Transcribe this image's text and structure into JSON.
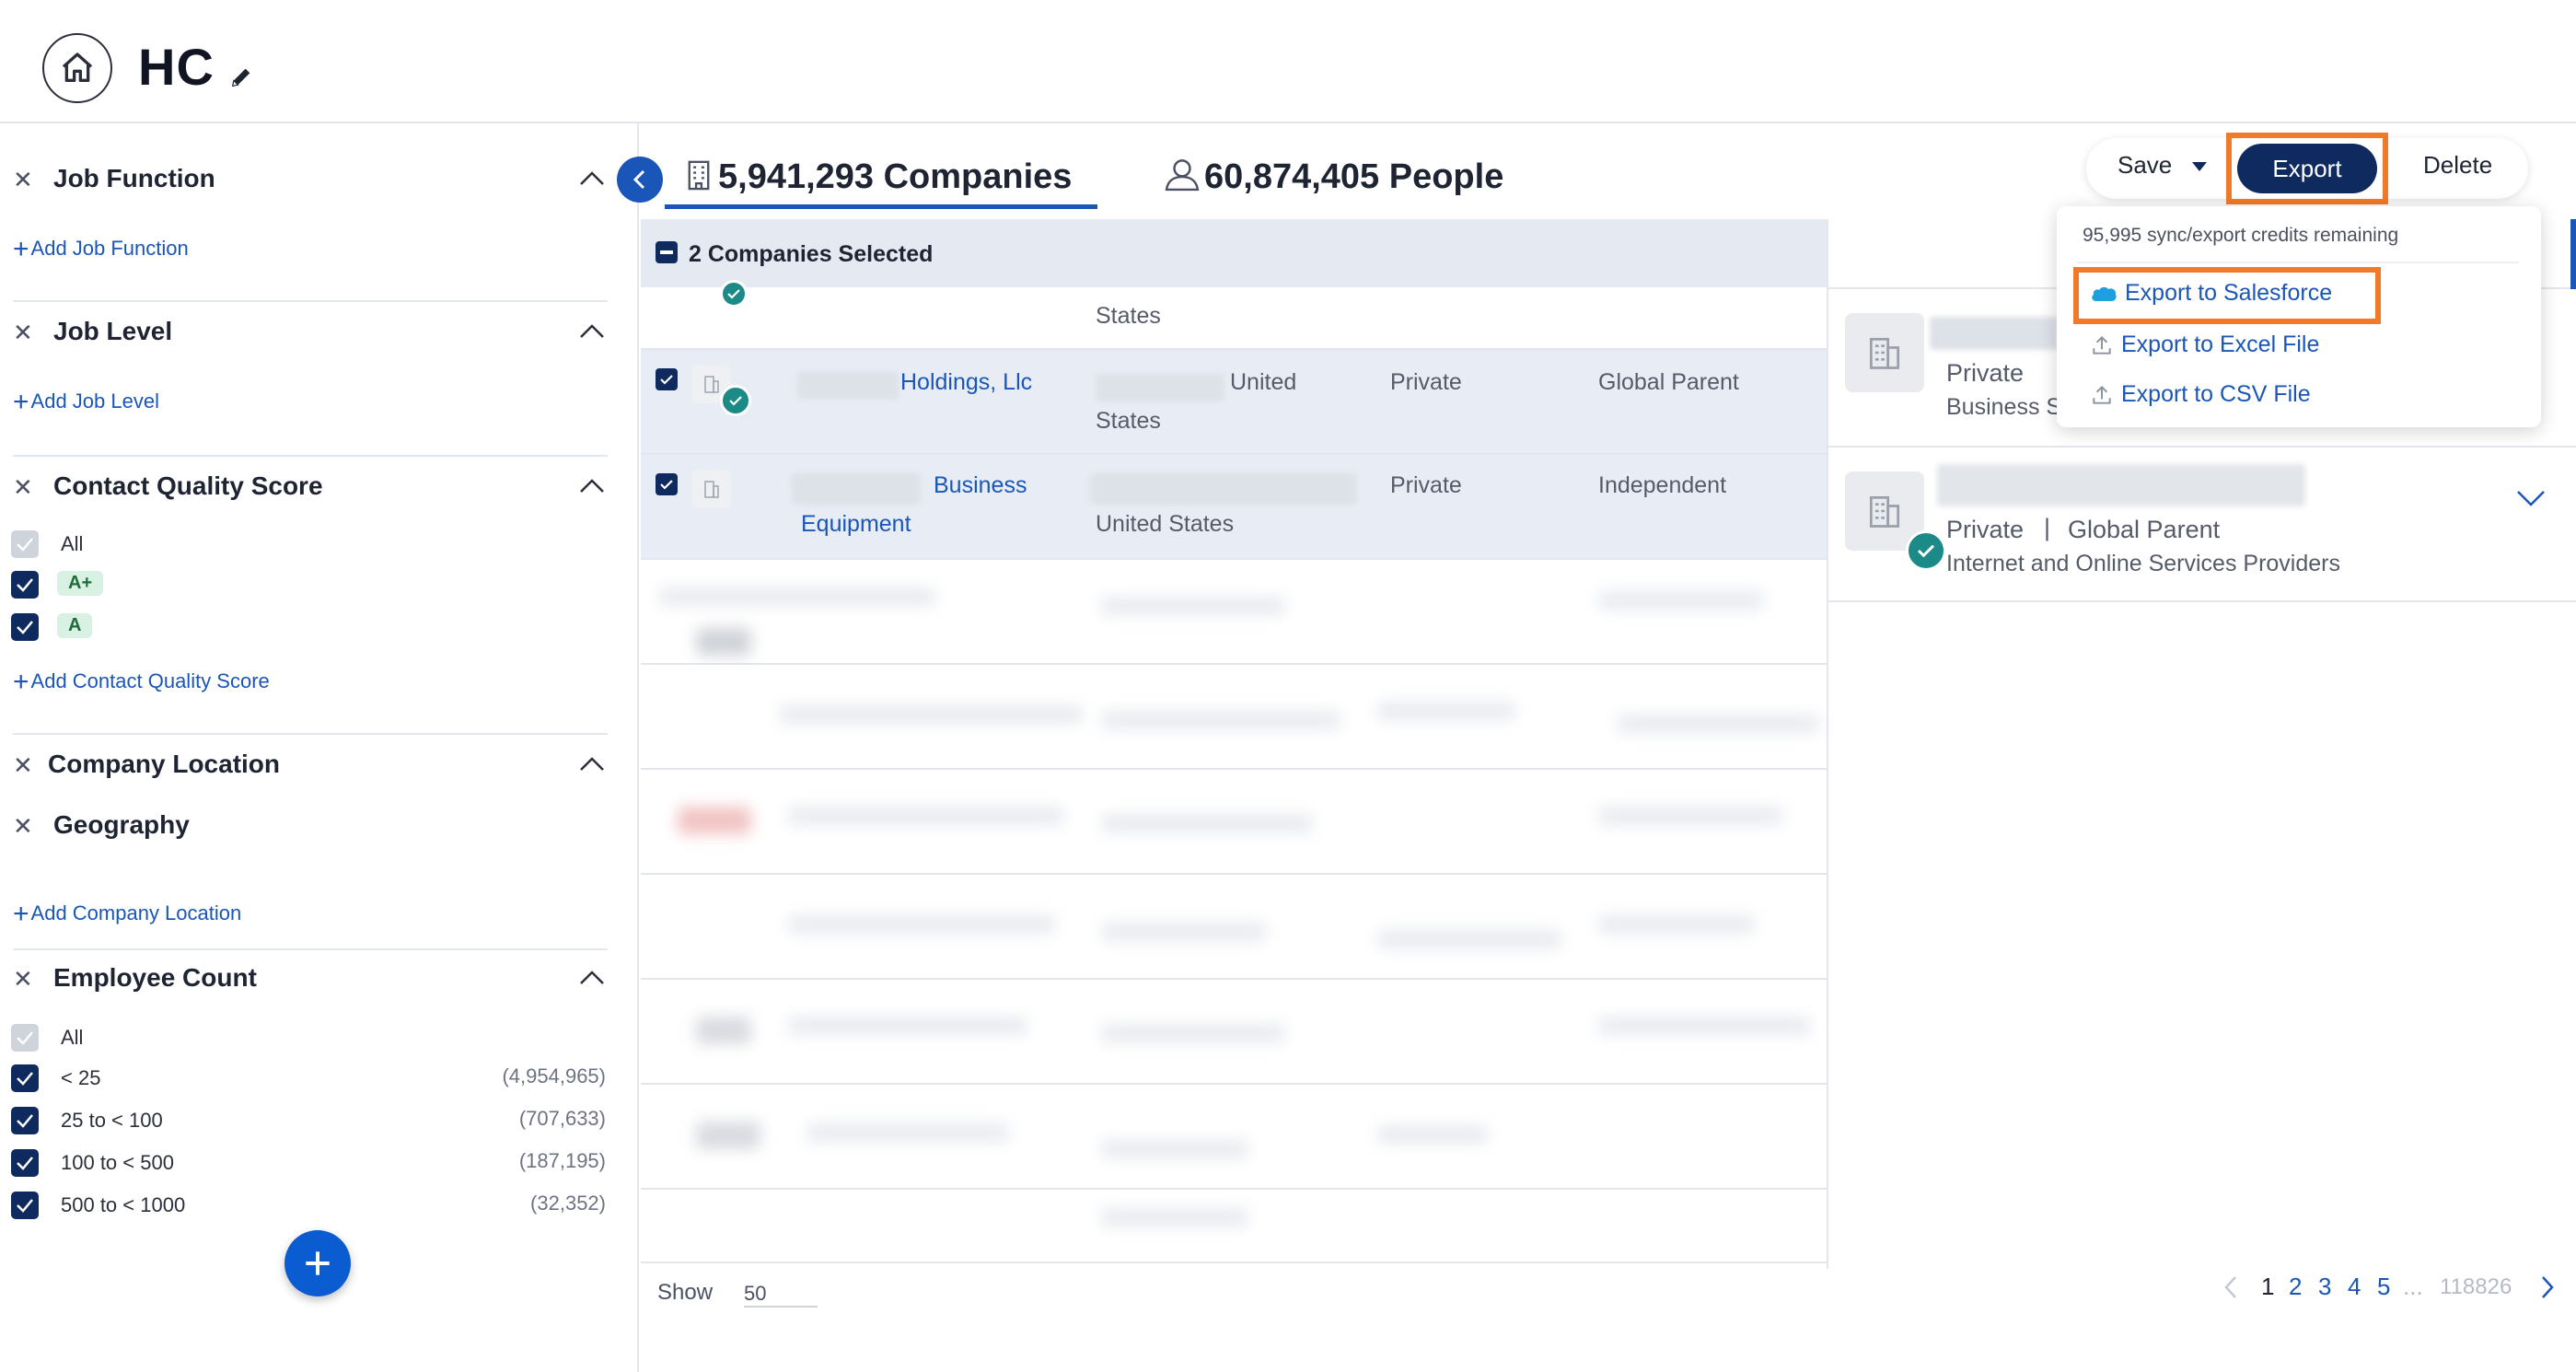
{
  "header": {
    "title": "HC"
  },
  "sidebar": {
    "job_function": {
      "title": "Job Function",
      "add": "Add Job Function"
    },
    "job_level": {
      "title": "Job Level",
      "add": "Add Job Level"
    },
    "contact_quality": {
      "title": "Contact Quality Score",
      "options": [
        "All",
        "A+",
        "A"
      ],
      "add": "Add Contact Quality Score"
    },
    "company_location": {
      "title": "Company Location",
      "sub": "Geography",
      "add": "Add Company Location"
    },
    "employee_count": {
      "title": "Employee Count",
      "options": [
        {
          "label": "All",
          "count": ""
        },
        {
          "label": "< 25",
          "count": "(4,954,965)"
        },
        {
          "label": "25 to < 100",
          "count": "(707,633)"
        },
        {
          "label": "100 to < 500",
          "count": "(187,195)"
        },
        {
          "label": "500 to < 1000",
          "count": "(32,352)"
        }
      ]
    }
  },
  "main": {
    "tabs": {
      "companies": "5,941,293 Companies",
      "people": "60,874,405 People"
    },
    "toolbar": {
      "save": "Save",
      "export": "Export",
      "delete": "Delete"
    },
    "selection": "2 Companies Selected",
    "rows": [
      {
        "name": "",
        "location": "States",
        "type": "",
        "relation": ""
      },
      {
        "name": "Holdings, Llc",
        "location_a": "United",
        "location_b": "States",
        "type": "Private",
        "relation": "Global Parent"
      },
      {
        "name_a": "Business",
        "name_b": "Equipment",
        "location": "United States",
        "type": "Private",
        "relation": "Independent"
      }
    ]
  },
  "dropdown": {
    "credits": "95,995 sync/export credits remaining",
    "items": [
      "Export to Salesforce",
      "Export to Excel File",
      "Export to CSV File"
    ]
  },
  "right_panel": {
    "card1": {
      "line1": "Private",
      "line2": "Business S"
    },
    "card2": {
      "type": "Private",
      "sep": "|",
      "relation": "Global Parent",
      "industry": "Internet and Online Services Providers"
    }
  },
  "footer": {
    "show_label": "Show",
    "show_value": "50",
    "pages": [
      "1",
      "2",
      "3",
      "4",
      "5"
    ],
    "dots": "...",
    "last_page": "118826"
  },
  "colors": {
    "accent": "#1a56b8",
    "navy": "#0f2a5e",
    "highlight": "#f07a2a",
    "teal": "#1c8a86"
  }
}
